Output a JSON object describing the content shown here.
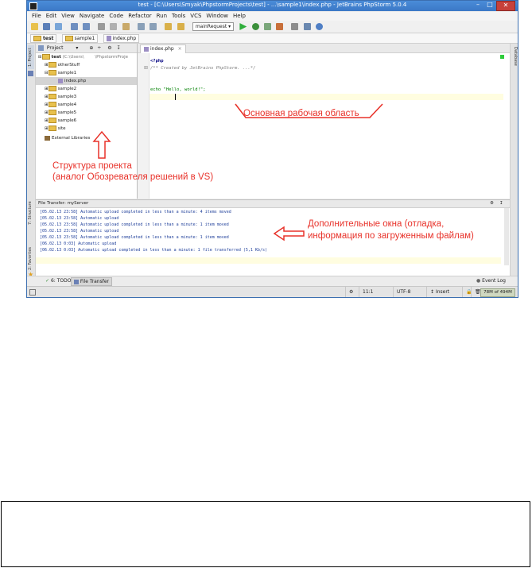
{
  "window": {
    "title": "test - [C:\\Users\\Smyak\\PhpstormProjects\\test] - ...\\sample1\\index.php - JetBrains PhpStorm 5.0.4"
  },
  "menu": [
    "File",
    "Edit",
    "View",
    "Navigate",
    "Code",
    "Refactor",
    "Run",
    "Tools",
    "VCS",
    "Window",
    "Help"
  ],
  "toolbar": {
    "run_config": "mainRequest"
  },
  "breadcrumbs": [
    "test",
    "sample1",
    "index.php"
  ],
  "left_strip": {
    "project_tab": "1: Project",
    "structure_tab": "7: Structure",
    "favorites_tab": "2: Favorites"
  },
  "right_strip": {
    "database_tab": "Database"
  },
  "project_panel": {
    "header": "Project",
    "tree": [
      {
        "label": "test",
        "path": "(C:\\Users\\",
        "path2": "\\PhpstormProje",
        "depth": 0,
        "type": "folder"
      },
      {
        "label": "otherStuff",
        "depth": 1,
        "type": "folder"
      },
      {
        "label": "sample1",
        "depth": 1,
        "type": "folder"
      },
      {
        "label": "index.php",
        "depth": 2,
        "type": "php",
        "selected": true
      },
      {
        "label": "sample2",
        "depth": 1,
        "type": "folder"
      },
      {
        "label": "sample3",
        "depth": 1,
        "type": "folder"
      },
      {
        "label": "sample4",
        "depth": 1,
        "type": "folder"
      },
      {
        "label": "sample5",
        "depth": 1,
        "type": "folder"
      },
      {
        "label": "sample6",
        "depth": 1,
        "type": "folder"
      },
      {
        "label": "site",
        "depth": 1,
        "type": "folder"
      },
      {
        "label": "External Libraries",
        "depth": 0,
        "type": "lib"
      }
    ]
  },
  "editor": {
    "tab": "index.php",
    "lines": [
      "<?php",
      "/** Created by JetBrains PhpStorm. ...*/",
      "",
      "echo \"Hello, world!\";"
    ]
  },
  "annotations": {
    "workspace": "Основная рабочая область",
    "structure_line1": "Структура проекта",
    "structure_line2": "(аналог Обозревателя решений в VS)",
    "windows_line1": "Дополнительные окна (отладка,",
    "windows_line2": "информация по загруженным файлам)"
  },
  "file_transfer": {
    "header": "File Transfer: myServer",
    "log": [
      "[05.02.13 23:58] Automatic upload completed in less than a minute: 4 items moved",
      "[05.02.13 23:58] Automatic upload",
      "[05.02.13 23:58] Automatic upload completed in less than a minute: 1 item moved",
      "[05.02.13 23:58] Automatic upload",
      "[05.02.13 23:58] Automatic upload completed in less than a minute: 1 item moved",
      "[06.02.13 0:03] Automatic upload",
      "[06.02.13 0:03] Automatic upload completed in less than a minute: 1 file transferred (5,1 Kb/s)"
    ]
  },
  "tool_tabs": {
    "todo": "6: TODO",
    "file_transfer": "File Transfer",
    "event_log": "Event Log"
  },
  "status": {
    "position": "11:1",
    "encoding": "UTF-8",
    "mode": "Insert",
    "memory": "78M of 494M"
  },
  "colors": {
    "titlebar": "#3b78c6",
    "annotation": "#e8322a",
    "log_text": "#1f3f9a",
    "code_comment": "#808080",
    "code_string": "#008000",
    "code_keyword": "#000080"
  }
}
